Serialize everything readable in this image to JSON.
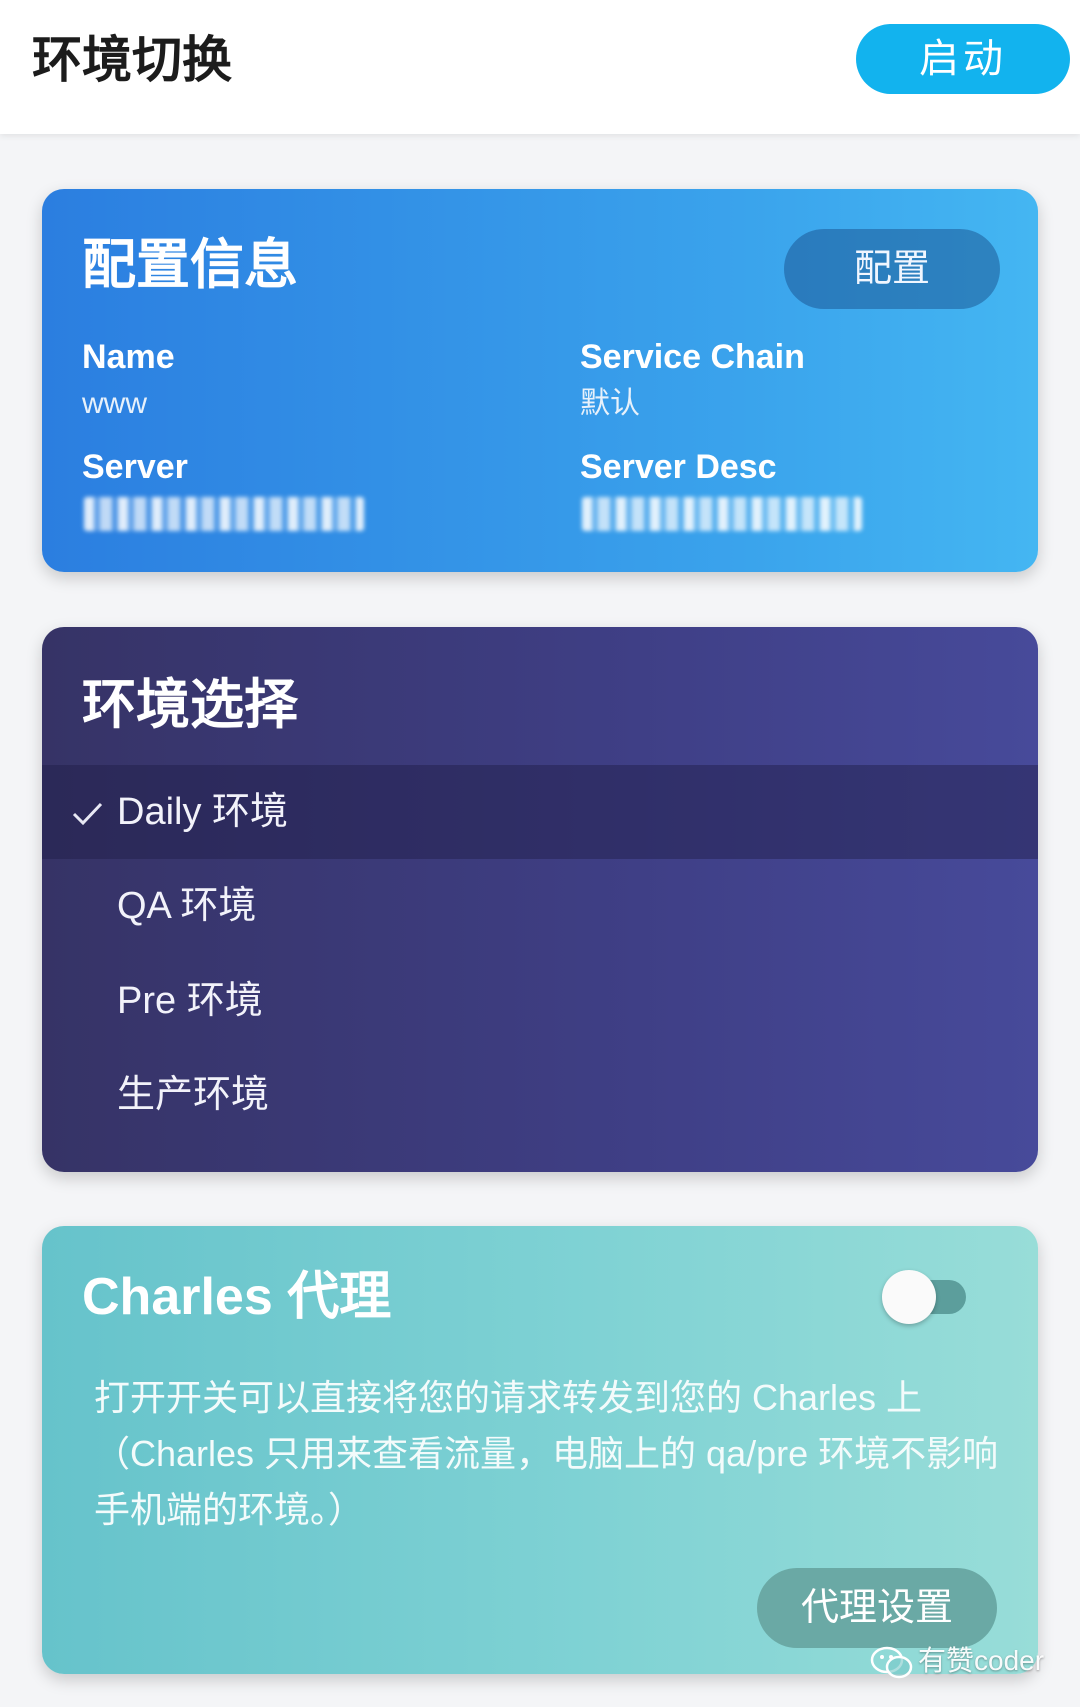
{
  "header": {
    "title": "环境切换",
    "start_label": "启动"
  },
  "config_card": {
    "title": "配置信息",
    "config_button": "配置",
    "fields": {
      "name_label": "Name",
      "name_value": "www",
      "service_chain_label": "Service Chain",
      "service_chain_value": "默认",
      "server_label": "Server",
      "server_desc_label": "Server Desc"
    }
  },
  "env_card": {
    "title": "环境选择",
    "items": [
      {
        "label": "Daily 环境",
        "selected": true
      },
      {
        "label": "QA 环境",
        "selected": false
      },
      {
        "label": "Pre 环境",
        "selected": false
      },
      {
        "label": "生产环境",
        "selected": false
      }
    ]
  },
  "charles_card": {
    "title": "Charles 代理",
    "toggle_on": false,
    "description": "打开开关可以直接将您的请求转发到您的 Charles 上（Charles 只用来查看流量，电脑上的 qa/pre 环境不影响手机端的环境。）",
    "proxy_button": "代理设置"
  },
  "watermark": {
    "text": "有赞coder",
    "icon": "wechat-icon"
  }
}
